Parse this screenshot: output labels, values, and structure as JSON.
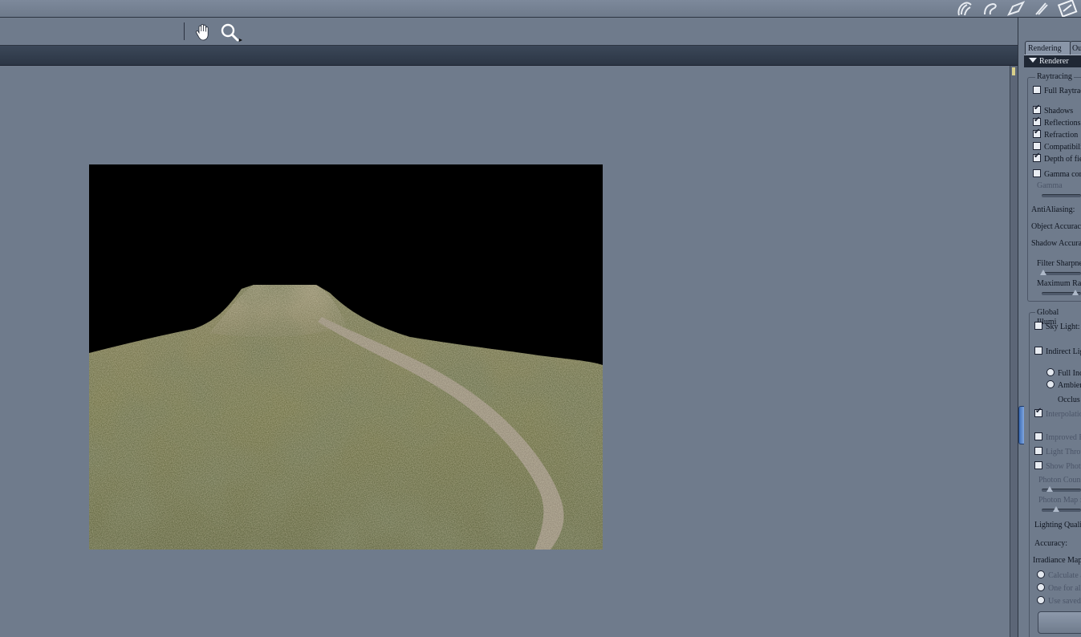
{
  "toolbar": {
    "tools": [
      "hand-icon",
      "zoom-icon"
    ],
    "room_icons": [
      "hand-room-icon",
      "cloth-room-icon",
      "face-room-icon",
      "hair-room-icon",
      "setup-room-icon"
    ]
  },
  "render_preview": {
    "scene": "grassy hill with stone path"
  },
  "panel": {
    "tabs": [
      "Rendering",
      "Ou"
    ],
    "section_title": "Renderer",
    "raytracing": {
      "legend": "Raytracing",
      "full_raytracing": "Full Raytrac",
      "options": [
        {
          "label": "Shadows",
          "checked": true
        },
        {
          "label": "Reflections",
          "checked": true
        },
        {
          "label": "Refraction",
          "checked": true
        },
        {
          "label": "Compatibili",
          "checked": false
        },
        {
          "label": "Depth of fie",
          "checked": true
        }
      ],
      "gamma_correction": "Gamma cor",
      "gamma_label": "Gamma",
      "antialiasing": "AntiAliasing:",
      "object_accuracy": "Object Accurac",
      "shadow_accuracy": "Shadow Accura",
      "filter_sharpness": "Filter Sharpne",
      "max_ray": "Maximum Ra"
    },
    "global_illumination": {
      "legend": "Global Illumi",
      "sky_light": "Sky Light:",
      "indirect_light": "Indirect Lig",
      "full_indirect": "Full Inc",
      "ambient": "Ambier",
      "occlusion": "Occlus",
      "interpolation": "Interpolatio",
      "improved": "Improved E",
      "light_through": "Light Throu",
      "show_photons": "Show Photo",
      "photon_count": "Photon Coun",
      "photon_map": "Photon Map :",
      "lighting_quality": "Lighting Quali",
      "accuracy": "Accuracy:",
      "irradiance_map": "Irradiance Map",
      "calc": "Calculate a",
      "one_for_all": "One for all",
      "use_saved": "Use saved"
    }
  }
}
